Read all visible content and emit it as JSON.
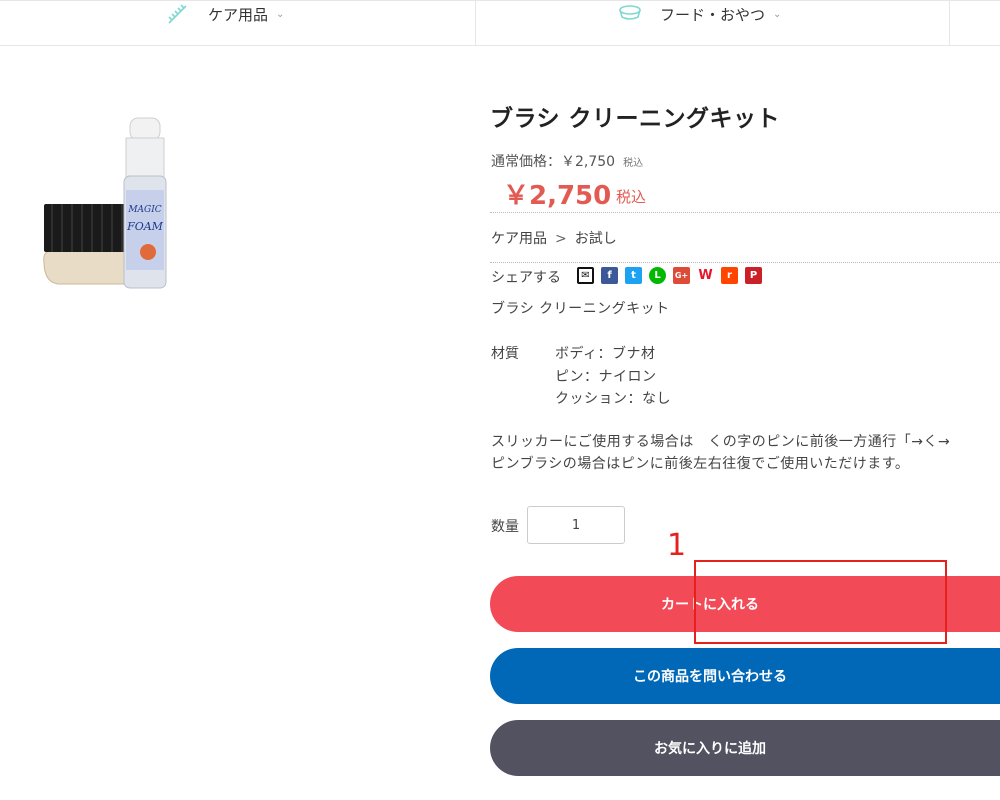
{
  "nav": {
    "items": [
      {
        "label": "ケア用品",
        "icon": "comb-icon"
      },
      {
        "label": "フード・おやつ",
        "icon": "food-bowl-icon"
      }
    ]
  },
  "product": {
    "title": "ブラシ クリーニングキット",
    "regular_price_label": "通常価格：￥2,750",
    "regular_tax": "税込",
    "price": "￥2,750",
    "price_tax": "税込",
    "breadcrumb": [
      "ケア用品",
      "お試し"
    ],
    "breadcrumb_sep": ">",
    "share_label": "シェアする",
    "share_icons": [
      {
        "name": "email",
        "color": "#222222",
        "glyph": "✉"
      },
      {
        "name": "facebook",
        "color": "#3b5998",
        "glyph": "f"
      },
      {
        "name": "twitter",
        "color": "#1da1f2",
        "glyph": "t"
      },
      {
        "name": "line",
        "color": "#00b900",
        "glyph": "L"
      },
      {
        "name": "google-plus",
        "color": "#dd4b39",
        "glyph": "G+"
      },
      {
        "name": "weibo",
        "color": "#e6162d",
        "glyph": "W"
      },
      {
        "name": "reddit",
        "color": "#ff4500",
        "glyph": "r"
      },
      {
        "name": "pinterest",
        "color": "#cb2027",
        "glyph": "P"
      }
    ],
    "description": "ブラシ クリーニングキット",
    "material_label": "材質",
    "materials": [
      "ボディ：ブナ材",
      "ピン：ナイロン",
      "クッション：なし"
    ],
    "usage_lines": [
      "スリッカーにご使用する場合は　くの字のピンに前後一方通行「→く→",
      "ピンブラシの場合はピンに前後左右往復でご使用いただけます。"
    ],
    "quantity_label": "数量",
    "quantity_value": "1"
  },
  "buttons": {
    "add_to_cart": "カートに入れる",
    "inquire": "この商品を問い合わせる",
    "favorite": "お気に入りに追加"
  },
  "annotation": {
    "number": "1",
    "color": "#e5211d"
  }
}
